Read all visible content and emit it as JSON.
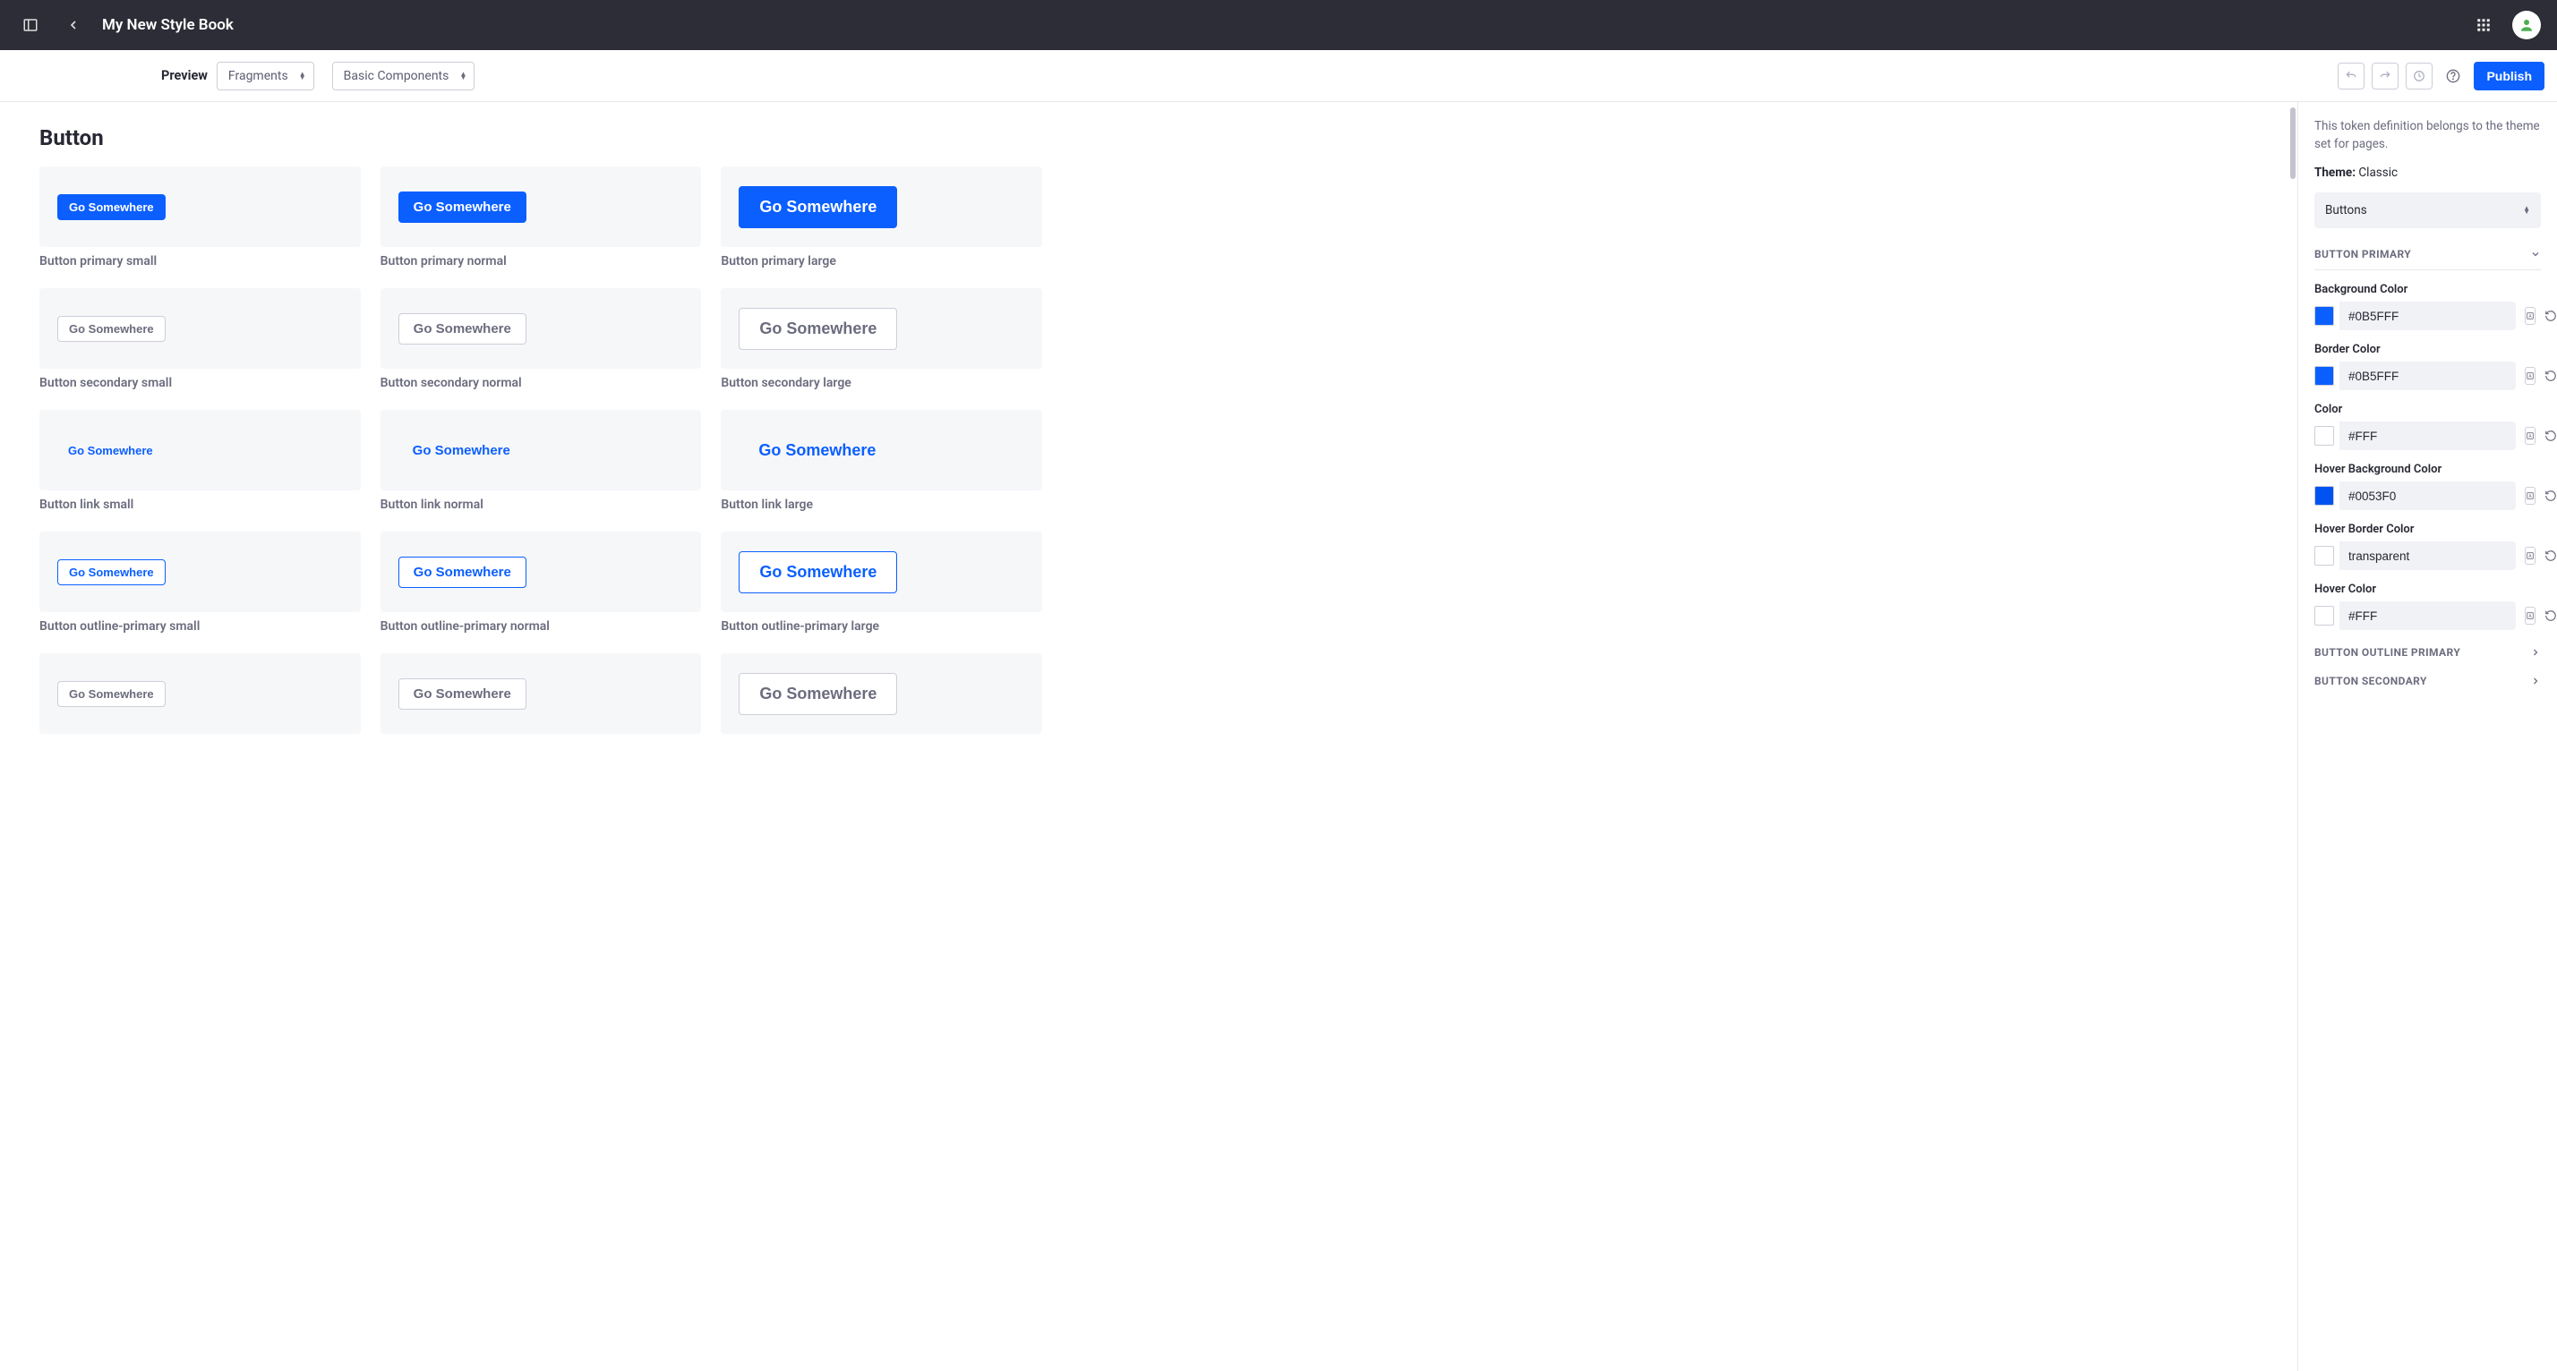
{
  "header": {
    "title": "My New Style Book"
  },
  "toolbar": {
    "preview_label": "Preview",
    "select1": "Fragments",
    "select2": "Basic Components",
    "publish": "Publish"
  },
  "canvas": {
    "section_title": "Button",
    "button_text": "Go Somewhere",
    "tiles": [
      {
        "style": "primary",
        "size": "sm",
        "label": "Button primary small"
      },
      {
        "style": "primary",
        "size": "md",
        "label": "Button primary normal"
      },
      {
        "style": "primary",
        "size": "lg",
        "label": "Button primary large"
      },
      {
        "style": "secondary",
        "size": "sm",
        "label": "Button secondary small"
      },
      {
        "style": "secondary",
        "size": "md",
        "label": "Button secondary normal"
      },
      {
        "style": "secondary",
        "size": "lg",
        "label": "Button secondary large"
      },
      {
        "style": "link",
        "size": "sm",
        "label": "Button link small"
      },
      {
        "style": "link",
        "size": "md",
        "label": "Button link normal"
      },
      {
        "style": "link",
        "size": "lg",
        "label": "Button link large"
      },
      {
        "style": "outline-primary",
        "size": "sm",
        "label": "Button outline-primary small"
      },
      {
        "style": "outline-primary",
        "size": "md",
        "label": "Button outline-primary normal"
      },
      {
        "style": "outline-primary",
        "size": "lg",
        "label": "Button outline-primary large"
      },
      {
        "style": "outline-secondary",
        "size": "sm",
        "label": ""
      },
      {
        "style": "outline-secondary",
        "size": "md",
        "label": ""
      },
      {
        "style": "outline-secondary",
        "size": "lg",
        "label": ""
      }
    ]
  },
  "sidebar": {
    "help": "This token definition belongs to the theme set for pages.",
    "theme_label": "Theme:",
    "theme_value": "Classic",
    "category": "Buttons",
    "group_primary": "BUTTON PRIMARY",
    "group_outline_primary": "BUTTON OUTLINE PRIMARY",
    "group_secondary": "BUTTON SECONDARY",
    "props": [
      {
        "label": "Background Color",
        "value": "#0B5FFF",
        "swatch": "#0B5FFF"
      },
      {
        "label": "Border Color",
        "value": "#0B5FFF",
        "swatch": "#0B5FFF"
      },
      {
        "label": "Color",
        "value": "#FFF",
        "swatch": "#FFFFFF"
      },
      {
        "label": "Hover Background Color",
        "value": "#0053F0",
        "swatch": "#0053F0"
      },
      {
        "label": "Hover Border Color",
        "value": "transparent",
        "swatch": "#FFFFFF"
      },
      {
        "label": "Hover Color",
        "value": "#FFF",
        "swatch": "#FFFFFF"
      }
    ]
  }
}
